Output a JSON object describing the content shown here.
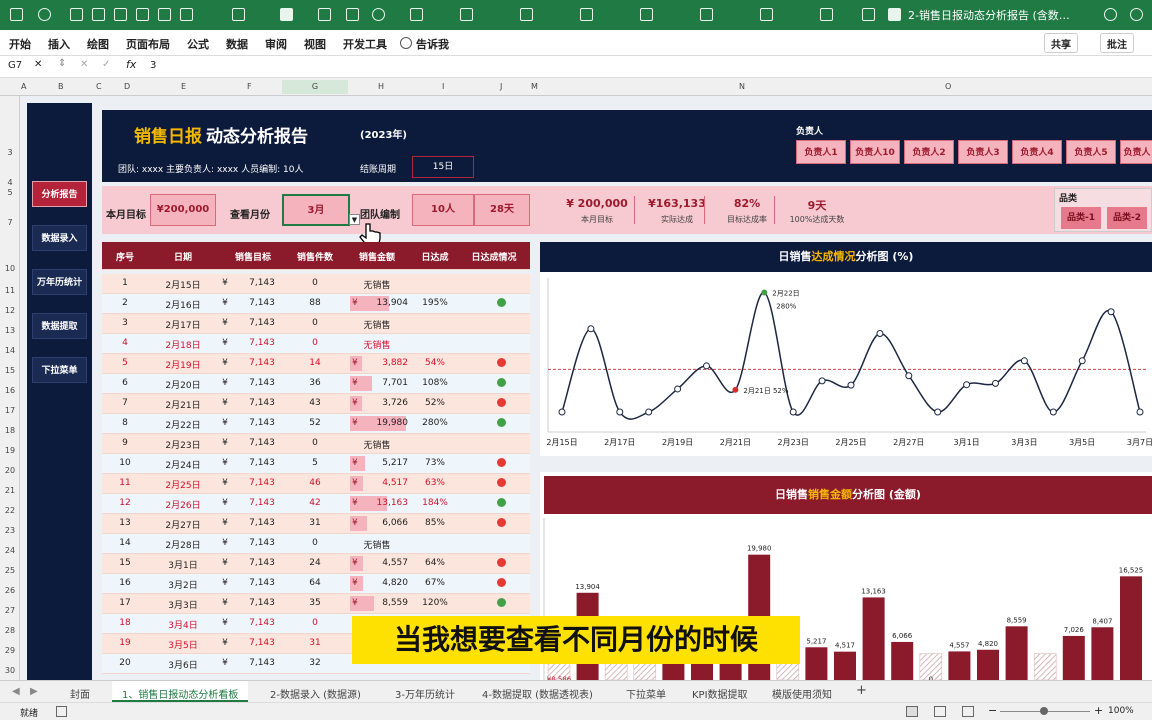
{
  "app": {
    "doc_title": "2-销售日报动态分析报告 (含数…"
  },
  "ribbon": {
    "tabs": [
      "开始",
      "插入",
      "绘图",
      "页面布局",
      "公式",
      "数据",
      "审阅",
      "视图",
      "开发工具",
      "告诉我"
    ],
    "share": "共享",
    "comment": "批注"
  },
  "formula_bar": {
    "cell_ref": "G7",
    "fx": "fx",
    "value": "3"
  },
  "columns": [
    "A",
    "B",
    "C",
    "D",
    "E",
    "F",
    "G",
    "H",
    "I",
    "J",
    "M",
    "N",
    "O"
  ],
  "rows": [
    "3",
    "4",
    "5",
    "7",
    "10",
    "11",
    "12",
    "13",
    "14",
    "15",
    "16",
    "17",
    "18",
    "19",
    "20",
    "21",
    "22",
    "23",
    "24",
    "25",
    "26",
    "27",
    "28",
    "29",
    "30"
  ],
  "sidebar": [
    "分析报告",
    "数据录入",
    "万年历统计",
    "数据提取",
    "下拉菜单"
  ],
  "header": {
    "title_accent": "销售日报",
    "title_rest": "动态分析报告",
    "year": "(2023年)",
    "team_info": "团队: xxxx  主要负责人: xxxx  人员编制: 10人",
    "period_label": "结账周期",
    "period_value": "15日",
    "owner_label": "负责人",
    "owners": [
      "负责人1",
      "负责人10",
      "负责人2",
      "负责人3",
      "负责人4",
      "负责人5",
      "负责人"
    ]
  },
  "controls": {
    "target_label": "本月目标",
    "target_value": "¥200,000",
    "month_label": "查看月份",
    "month_value": "3月",
    "team_label": "团队编制",
    "team_value": "10人",
    "days_value": "28天",
    "kpis": [
      {
        "value": "¥  200,000",
        "label": "本月目标"
      },
      {
        "value": "¥163,133",
        "label": "实际达成"
      },
      {
        "value": "82%",
        "label": "目标达成率"
      },
      {
        "value": "9天",
        "label": "100%达成天数"
      }
    ],
    "category_label": "品类",
    "categories": [
      "品类-1",
      "品类-2"
    ]
  },
  "table": {
    "headers": [
      "序号",
      "日期",
      "销售目标",
      "销售件数",
      "销售金额",
      "日达成",
      "日达成情况"
    ],
    "rows": [
      {
        "no": "1",
        "date": "2月15日",
        "cur": "¥",
        "target": "7,143",
        "qty": "0",
        "amt": "无销售",
        "rate": "",
        "status": "",
        "red": false
      },
      {
        "no": "2",
        "date": "2月16日",
        "cur": "¥",
        "target": "7,143",
        "qty": "88",
        "amt": "13,904",
        "rate": "195%",
        "status": "green",
        "red": false
      },
      {
        "no": "3",
        "date": "2月17日",
        "cur": "¥",
        "target": "7,143",
        "qty": "0",
        "amt": "无销售",
        "rate": "",
        "status": "",
        "red": false
      },
      {
        "no": "4",
        "date": "2月18日",
        "cur": "¥",
        "target": "7,143",
        "qty": "0",
        "amt": "无销售",
        "rate": "",
        "status": "",
        "red": true
      },
      {
        "no": "5",
        "date": "2月19日",
        "cur": "¥",
        "target": "7,143",
        "qty": "14",
        "amt": "3,882",
        "rate": "54%",
        "status": "red",
        "red": true
      },
      {
        "no": "6",
        "date": "2月20日",
        "cur": "¥",
        "target": "7,143",
        "qty": "36",
        "amt": "7,701",
        "rate": "108%",
        "status": "green",
        "red": false
      },
      {
        "no": "7",
        "date": "2月21日",
        "cur": "¥",
        "target": "7,143",
        "qty": "43",
        "amt": "3,726",
        "rate": "52%",
        "status": "red",
        "red": false
      },
      {
        "no": "8",
        "date": "2月22日",
        "cur": "¥",
        "target": "7,143",
        "qty": "52",
        "amt": "19,980",
        "rate": "280%",
        "status": "green",
        "red": false
      },
      {
        "no": "9",
        "date": "2月23日",
        "cur": "¥",
        "target": "7,143",
        "qty": "0",
        "amt": "无销售",
        "rate": "",
        "status": "",
        "red": false
      },
      {
        "no": "10",
        "date": "2月24日",
        "cur": "¥",
        "target": "7,143",
        "qty": "5",
        "amt": "5,217",
        "rate": "73%",
        "status": "red",
        "red": false
      },
      {
        "no": "11",
        "date": "2月25日",
        "cur": "¥",
        "target": "7,143",
        "qty": "46",
        "amt": "4,517",
        "rate": "63%",
        "status": "red",
        "red": true
      },
      {
        "no": "12",
        "date": "2月26日",
        "cur": "¥",
        "target": "7,143",
        "qty": "42",
        "amt": "13,163",
        "rate": "184%",
        "status": "green",
        "red": true
      },
      {
        "no": "13",
        "date": "2月27日",
        "cur": "¥",
        "target": "7,143",
        "qty": "31",
        "amt": "6,066",
        "rate": "85%",
        "status": "red",
        "red": false
      },
      {
        "no": "14",
        "date": "2月28日",
        "cur": "¥",
        "target": "7,143",
        "qty": "0",
        "amt": "无销售",
        "rate": "",
        "status": "",
        "red": false
      },
      {
        "no": "15",
        "date": "3月1日",
        "cur": "¥",
        "target": "7,143",
        "qty": "24",
        "amt": "4,557",
        "rate": "64%",
        "status": "red",
        "red": false
      },
      {
        "no": "16",
        "date": "3月2日",
        "cur": "¥",
        "target": "7,143",
        "qty": "64",
        "amt": "4,820",
        "rate": "67%",
        "status": "red",
        "red": false
      },
      {
        "no": "17",
        "date": "3月3日",
        "cur": "¥",
        "target": "7,143",
        "qty": "35",
        "amt": "8,559",
        "rate": "120%",
        "status": "green",
        "red": false
      },
      {
        "no": "18",
        "date": "3月4日",
        "cur": "¥",
        "target": "7,143",
        "qty": "0",
        "amt": "",
        "rate": "",
        "status": "",
        "red": true
      },
      {
        "no": "19",
        "date": "3月5日",
        "cur": "¥",
        "target": "7,143",
        "qty": "31",
        "amt": "",
        "rate": "",
        "status": "",
        "red": true
      },
      {
        "no": "20",
        "date": "3月6日",
        "cur": "¥",
        "target": "7,143",
        "qty": "32",
        "amt": "",
        "rate": "",
        "status": "",
        "red": false
      }
    ]
  },
  "line_panel_title": {
    "a": "日销售",
    "b": "达成情况",
    "c": "分析图 (%)"
  },
  "bar_panel_title": {
    "a": "日销售",
    "b": "销售金额",
    "c": "分析图 (金额)"
  },
  "chart_data": [
    {
      "type": "line",
      "x": [
        "2月15日",
        "2月16日",
        "2月17日",
        "2月18日",
        "2月19日",
        "2月20日",
        "2月21日",
        "2月22日",
        "2月23日",
        "2月24日",
        "2月25日",
        "2月26日",
        "2月27日",
        "2月28日",
        "3月1日",
        "3月2日",
        "3月3日",
        "3月4日",
        "3月5日",
        "3月6日",
        "3月7日"
      ],
      "x_tick_labels": [
        "2月15日",
        "2月17日",
        "2月19日",
        "2月21日",
        "2月23日",
        "2月25日",
        "2月27日",
        "3月1日",
        "3月3日",
        "3月5日",
        "3月7日"
      ],
      "values": [
        0,
        195,
        0,
        0,
        54,
        108,
        52,
        280,
        0,
        73,
        63,
        184,
        85,
        0,
        64,
        67,
        120,
        0,
        120,
        235,
        0
      ],
      "annotations": [
        {
          "x": "2月22日",
          "text": "2月22日",
          "sub": "280%"
        },
        {
          "x": "2月21日",
          "text": "2月21日 52%"
        }
      ],
      "ylim": [
        0,
        300
      ]
    },
    {
      "type": "bar",
      "x": [
        "2月15日",
        "2月16日",
        "2月17日",
        "2月18日",
        "2月19日",
        "2月20日",
        "2月21日",
        "2月22日",
        "2月23日",
        "2月24日",
        "2月25日",
        "2月26日",
        "2月27日",
        "2月28日",
        "3月1日",
        "3月2日",
        "3月3日",
        "3月4日",
        "3月5日",
        "3月6日",
        "3月7日"
      ],
      "values": [
        0,
        13904,
        0,
        0,
        3882,
        7701,
        3726,
        19980,
        0,
        5217,
        4517,
        13163,
        6066,
        0,
        4557,
        4820,
        8559,
        0,
        7026,
        8407,
        16525
      ],
      "labels": [
        "¥8,586",
        "13,904",
        "",
        "",
        "",
        "7,701",
        "",
        "19,980",
        "",
        "5,217",
        "4,517",
        "13,163",
        "6,066",
        "0",
        "4,557",
        "4,820",
        "8,559",
        "",
        "7,026",
        "8,407",
        "16,525"
      ],
      "ylim": [
        0,
        22000
      ]
    }
  ],
  "subtitle": "当我想要查看不同月份的时候",
  "sheet_tabs": [
    "封面",
    "1、销售日报动态分析看板",
    "2-数据录入 (数据源)",
    "3-万年历统计",
    "4-数据提取 (数据透视表)",
    "下拉菜单",
    "KPI数据提取",
    "模版使用须知",
    "+"
  ],
  "status": {
    "ready": "就绪",
    "zoom": "100%"
  }
}
